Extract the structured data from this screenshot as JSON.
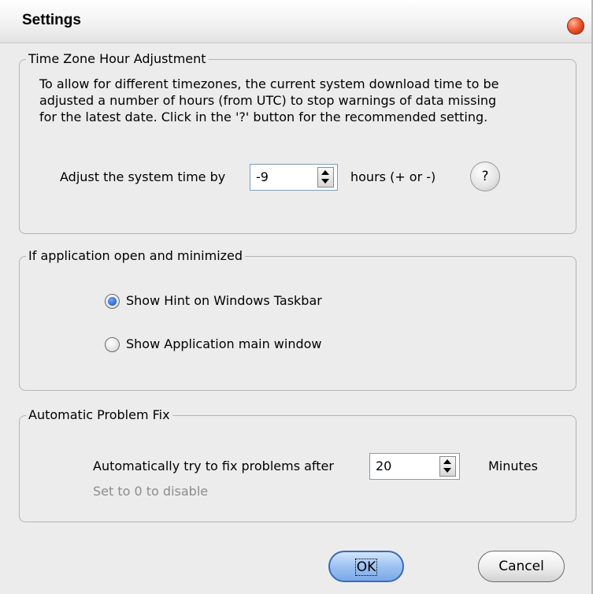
{
  "window": {
    "title": "Settings"
  },
  "timezone": {
    "group_title": "Time Zone Hour Adjustment",
    "description_lines": [
      "To allow for different timezones, the current system download time to be",
      "adjusted a number of hours (from UTC) to stop warnings of data missing",
      "for the latest date. Click in the '?' button for the recommended setting."
    ],
    "adjust_label": "Adjust the system time by",
    "adjust_value": "-9",
    "units_label": "hours (+ or -)",
    "help_label": "?"
  },
  "minimized": {
    "group_title": "If application open and minimized",
    "options": [
      {
        "label": "Show Hint on Windows Taskbar",
        "checked": true
      },
      {
        "label": "Show Application main window",
        "checked": false
      }
    ]
  },
  "autofix": {
    "group_title": "Automatic Problem Fix",
    "label": "Automatically try to fix problems after",
    "value": "20",
    "units_label": "Minutes",
    "hint": "Set to 0 to disable"
  },
  "buttons": {
    "ok_label": "OK",
    "cancel_label": "Cancel"
  },
  "colors": {
    "accent": "#1646b4",
    "close": "#ee5a33",
    "ok_button": "#9cc2f2"
  },
  "icons": {
    "close": "close-icon",
    "spin_up": "arrow-up-icon",
    "spin_down": "arrow-down-icon",
    "help": "question-icon"
  }
}
